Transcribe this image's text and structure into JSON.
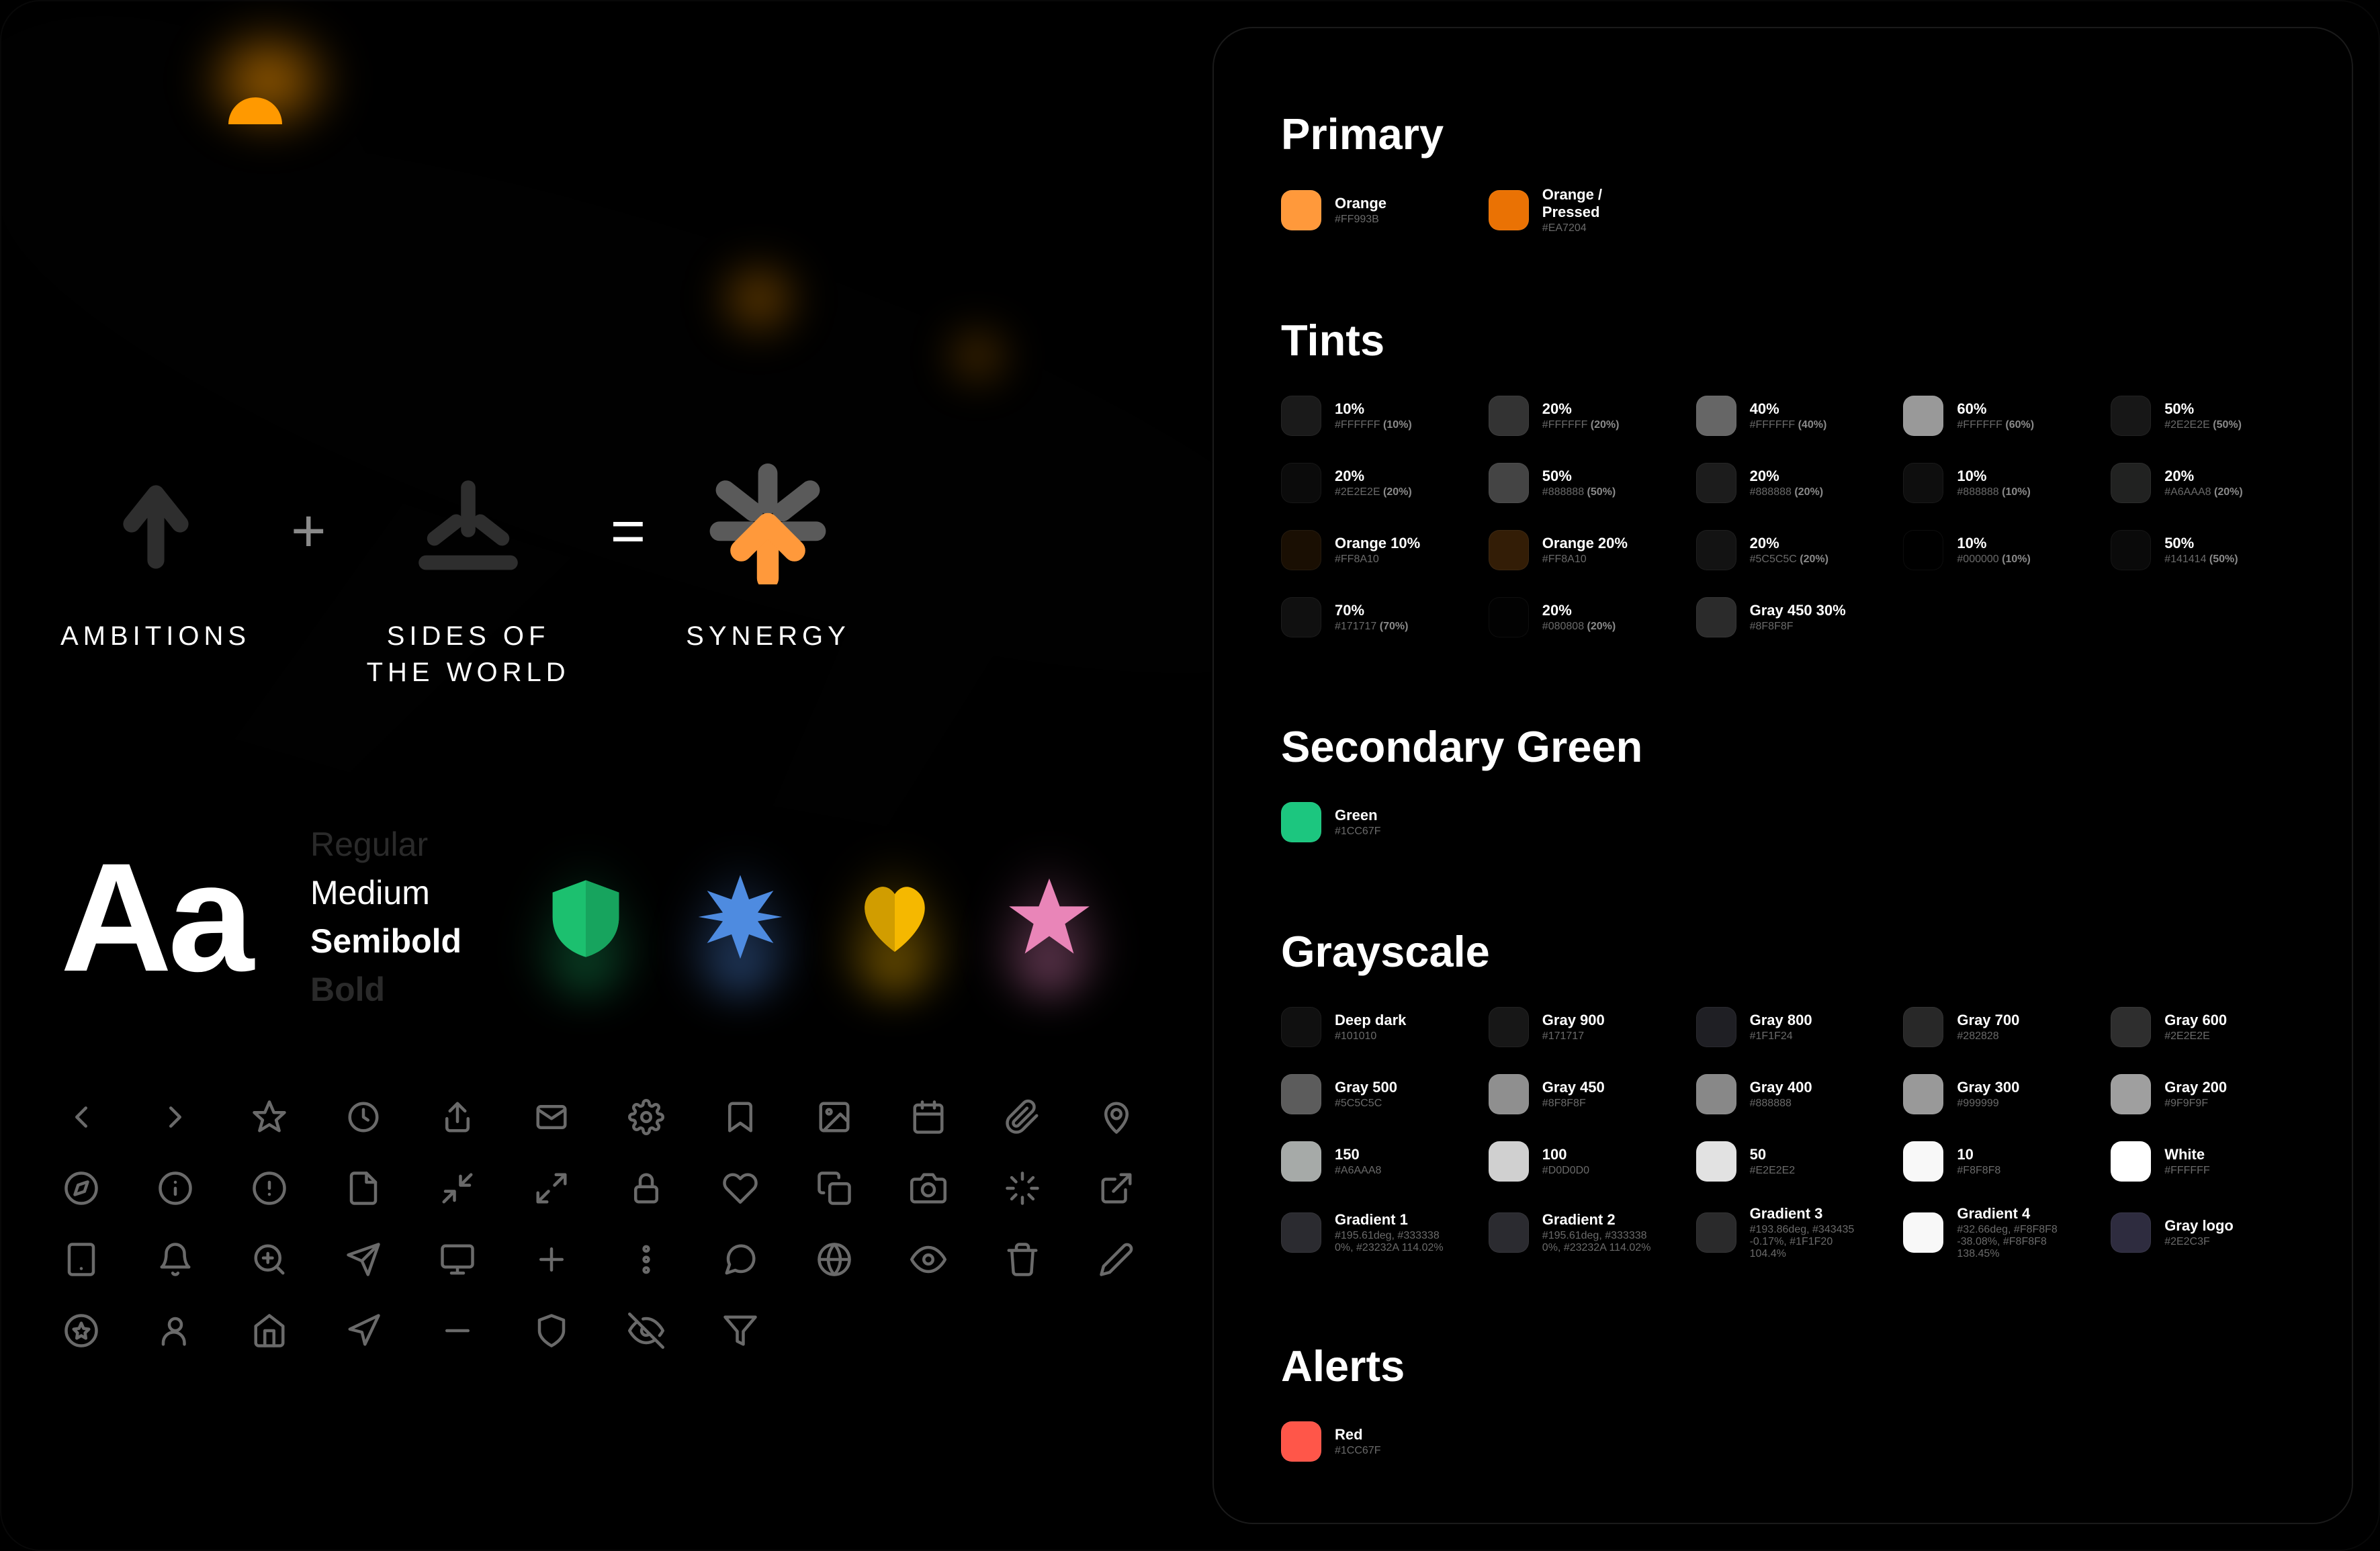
{
  "equation": {
    "ambitions": "AMBITIONS",
    "sides": "SIDES OF\nTHE WORLD",
    "synergy": "SYNERGY",
    "plus": "+",
    "equals": "="
  },
  "typography": {
    "sample": "Aa",
    "weights": {
      "regular": "Regular",
      "medium": "Medium",
      "semibold": "Semibold",
      "bold": "Bold"
    }
  },
  "shapes_accent": {
    "green": "#1CC06F",
    "blue": "#4E8BE0",
    "yellow": "#F5B800",
    "pink": "#E985B8"
  },
  "icons": [
    "chevron-left",
    "chevron-right",
    "star",
    "clock",
    "share",
    "mail",
    "settings",
    "bookmark",
    "image",
    "calendar",
    "paperclip",
    "location",
    "compass",
    "info",
    "alert",
    "file",
    "minimize",
    "maximize",
    "lock",
    "heart",
    "copy",
    "camera",
    "loading",
    "external-link",
    "tablet",
    "bell",
    "zoom",
    "send",
    "monitor",
    "plus",
    "more-vertical",
    "chat",
    "globe",
    "eye",
    "trash",
    "edit",
    "star-badge",
    "user",
    "home",
    "navigate",
    "minus",
    "shield",
    "eye-off",
    "filter"
  ],
  "colors": {
    "primary": {
      "title": "Primary",
      "items": [
        {
          "name": "Orange",
          "hex": "#FF993B",
          "color": "#FF993B"
        },
        {
          "name": "Orange / Pressed",
          "hex": "#EA7204",
          "color": "#EA7204"
        }
      ]
    },
    "tints": {
      "title": "Tints",
      "items": [
        {
          "name": "10%",
          "hex": "#FFFFFF",
          "pct": "(10%)",
          "color": "#1a1a1a"
        },
        {
          "name": "20%",
          "hex": "#FFFFFF",
          "pct": "(20%)",
          "color": "#333333"
        },
        {
          "name": "40%",
          "hex": "#FFFFFF",
          "pct": "(40%)",
          "color": "#666666"
        },
        {
          "name": "60%",
          "hex": "#FFFFFF",
          "pct": "(60%)",
          "color": "#999999"
        },
        {
          "name": "50%",
          "hex": "#2E2E2E",
          "pct": "(50%)",
          "color": "#171717"
        },
        {
          "name": "20%",
          "hex": "#2E2E2E",
          "pct": "(20%)",
          "color": "#0b0b0b"
        },
        {
          "name": "50%",
          "hex": "#888888",
          "pct": "(50%)",
          "color": "#444444"
        },
        {
          "name": "20%",
          "hex": "#888888",
          "pct": "(20%)",
          "color": "#1c1c1c"
        },
        {
          "name": "10%",
          "hex": "#888888",
          "pct": "(10%)",
          "color": "#0e0e0e"
        },
        {
          "name": "20%",
          "hex": "#A6AAA8",
          "pct": "(20%)",
          "color": "#212221"
        },
        {
          "name": "Orange 10%",
          "hex": "#FF8A10",
          "pct": "",
          "color": "#1a0f03"
        },
        {
          "name": "Orange 20%",
          "hex": "#FF8A10",
          "pct": "",
          "color": "#331d06"
        },
        {
          "name": "20%",
          "hex": "#5C5C5C",
          "pct": "(20%)",
          "color": "#131313"
        },
        {
          "name": "10%",
          "hex": "#000000",
          "pct": "(10%)",
          "color": "#000000"
        },
        {
          "name": "50%",
          "hex": "#141414",
          "pct": "(50%)",
          "color": "#0a0a0a"
        },
        {
          "name": "70%",
          "hex": "#171717",
          "pct": "(70%)",
          "color": "#101010"
        },
        {
          "name": "20%",
          "hex": "#080808",
          "pct": "(20%)",
          "color": "#020202"
        },
        {
          "name": "Gray 450 30%",
          "hex": "#8F8F8F",
          "pct": "",
          "color": "#2b2b2b"
        },
        {
          "name": "",
          "hex": "",
          "pct": "",
          "color": "",
          "empty": true
        },
        {
          "name": "",
          "hex": "",
          "pct": "",
          "color": "",
          "empty": true
        }
      ]
    },
    "secondary": {
      "title": "Secondary Green",
      "items": [
        {
          "name": "Green",
          "hex": "#1CC67F",
          "color": "#1CC67F"
        }
      ]
    },
    "grayscale": {
      "title": "Grayscale",
      "items": [
        {
          "name": "Deep dark",
          "hex": "#101010",
          "color": "#101010"
        },
        {
          "name": "Gray 900",
          "hex": "#171717",
          "color": "#171717"
        },
        {
          "name": "Gray 800",
          "hex": "#1F1F24",
          "color": "#1F1F24"
        },
        {
          "name": "Gray 700",
          "hex": "#282828",
          "color": "#282828"
        },
        {
          "name": "Gray 600",
          "hex": "#2E2E2E",
          "color": "#2E2E2E"
        },
        {
          "name": "Gray 500",
          "hex": "#5C5C5C",
          "color": "#5C5C5C"
        },
        {
          "name": "Gray 450",
          "hex": "#8F8F8F",
          "color": "#8F8F8F"
        },
        {
          "name": "Gray 400",
          "hex": "#888888",
          "color": "#888888"
        },
        {
          "name": "Gray 300",
          "hex": "#999999",
          "color": "#999999"
        },
        {
          "name": "Gray 200",
          "hex": "#9F9F9F",
          "color": "#9F9F9F"
        },
        {
          "name": "150",
          "hex": "#A6AAA8",
          "color": "#A6AAA8"
        },
        {
          "name": "100",
          "hex": "#D0D0D0",
          "color": "#D0D0D0"
        },
        {
          "name": "50",
          "hex": "#E2E2E2",
          "color": "#E2E2E2"
        },
        {
          "name": "10",
          "hex": "#F8F8F8",
          "color": "#F8F8F8"
        },
        {
          "name": "White",
          "hex": "#FFFFFF",
          "color": "#FFFFFF"
        },
        {
          "name": "Gradient 1",
          "hex": "#195.61deg, #333338 0%, #23232A 114.02%",
          "color": "#2b2b30"
        },
        {
          "name": "Gradient 2",
          "hex": "#195.61deg, #333338 0%, #23232A 114.02%",
          "color": "#2b2b30"
        },
        {
          "name": "Gradient 3",
          "hex": "#193.86deg, #343435 -0.17%, #1F1F20 104.4%",
          "color": "#2a2a2b"
        },
        {
          "name": "Gradient 4",
          "hex": "#32.66deg, #F8F8F8 -38.08%, #F8F8F8 138.45%",
          "color": "#F8F8F8"
        },
        {
          "name": "Gray logo",
          "hex": "#2E2C3F",
          "color": "#2E2C3F"
        }
      ]
    },
    "alerts": {
      "title": "Alerts",
      "items": [
        {
          "name": "Red",
          "hex": "#1CC67F",
          "color": "#FF5649"
        }
      ]
    }
  }
}
